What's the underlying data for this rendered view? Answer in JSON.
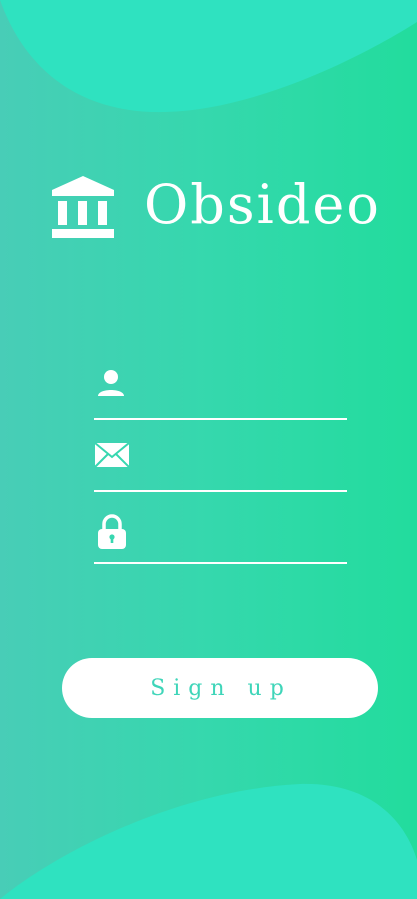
{
  "brand": {
    "name": "Obsideo",
    "icon": "bank-building-icon"
  },
  "form": {
    "username": {
      "icon": "user-icon",
      "value": "",
      "placeholder": ""
    },
    "email": {
      "icon": "envelope-icon",
      "value": "",
      "placeholder": ""
    },
    "password": {
      "icon": "lock-icon",
      "value": "",
      "placeholder": ""
    },
    "submit_label": "Sign up"
  },
  "colors": {
    "gradient_start": "#48cdb7",
    "gradient_end": "#22dc9d",
    "blob": "#2fe2c0",
    "button_text": "#3fd5b9",
    "foreground": "#ffffff"
  }
}
